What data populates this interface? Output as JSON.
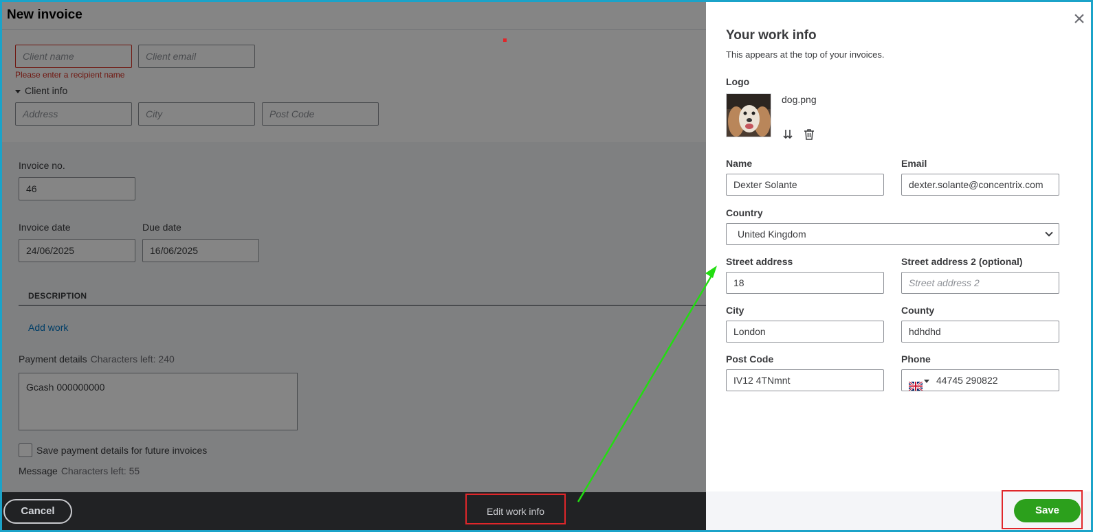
{
  "invoice": {
    "title": "New invoice",
    "client_name_placeholder": "Client name",
    "client_email_placeholder": "Client email",
    "client_name_error": "Please enter a recipient name",
    "client_info_label": "Client info",
    "address_placeholder": "Address",
    "city_placeholder": "City",
    "post_code_placeholder": "Post Code",
    "invoice_no_label": "Invoice no.",
    "invoice_no_value": "46",
    "invoice_date_label": "Invoice date",
    "invoice_date_value": "24/06/2025",
    "due_date_label": "Due date",
    "due_date_value": "16/06/2025",
    "description_header": "DESCRIPTION",
    "add_work_link": "Add work",
    "payment_details_label": "Payment details",
    "payment_chars_left": "Characters left: 240",
    "payment_details_value": "Gcash 000000000",
    "save_payment_checkbox_label": "Save payment details for future invoices",
    "message_label": "Message",
    "message_chars_left": "Characters left: 55"
  },
  "bottom_bar": {
    "cancel_label": "Cancel",
    "edit_work_info_label": "Edit work info"
  },
  "drawer": {
    "title": "Your work info",
    "subtitle": "This appears at the top of your invoices.",
    "logo_label": "Logo",
    "logo_file_name": "dog.png",
    "name_label": "Name",
    "name_value": "Dexter Solante",
    "email_label": "Email",
    "email_value": "dexter.solante@concentrix.com",
    "country_label": "Country",
    "country_value": "United Kingdom",
    "street_label": "Street address",
    "street_value": "18",
    "street2_label": "Street address 2 (optional)",
    "street2_placeholder": "Street address 2",
    "city_label": "City",
    "city_value": "London",
    "county_label": "County",
    "county_value": "hdhdhd",
    "post_code_label": "Post Code",
    "post_code_value": "IV12 4TNmnt",
    "phone_label": "Phone",
    "phone_value": "44745 290822",
    "save_label": "Save"
  },
  "colors": {
    "accent_green": "#2ca01c",
    "error_red": "#d52b1e",
    "annotation_red": "#e0262a",
    "annotation_green": "#22dd11",
    "link_blue": "#0077c5",
    "frame_cyan": "#1ba3c9"
  }
}
